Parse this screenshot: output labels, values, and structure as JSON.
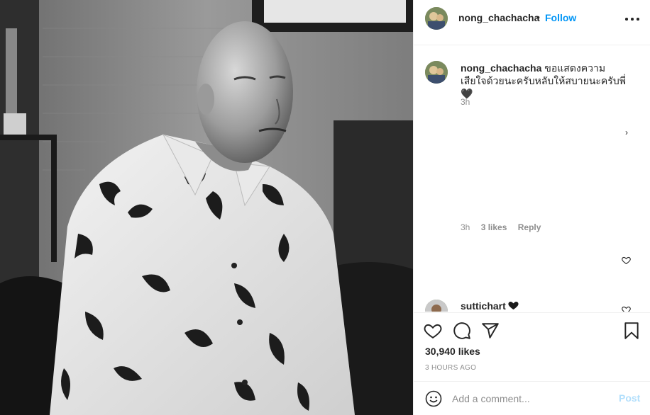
{
  "header": {
    "username": "nong_chachacha",
    "separator": "•",
    "follow_label": "Follow",
    "more_icon": "more-options-icon"
  },
  "caption": {
    "username": "nong_chachacha",
    "text": "ขอแสดงความเสียใจด้วยนะครับหลับให้สบายนะครับพี่🖤",
    "time": "3h"
  },
  "comment_meta": {
    "time": "3h",
    "likes": "3 likes",
    "reply": "Reply"
  },
  "chevron": "›",
  "comment2": {
    "username": "suttichart",
    "emoji_icon": "black-heart-icon"
  },
  "actions": {
    "like_icon": "heart-icon",
    "comment_icon": "comment-icon",
    "share_icon": "share-icon",
    "save_icon": "bookmark-icon"
  },
  "likes_count": "30,940 likes",
  "posted_ago": "3 HOURS AGO",
  "add_comment": {
    "placeholder": "Add a comment...",
    "value": "",
    "post_label": "Post"
  },
  "colors": {
    "link_blue": "#0095f6",
    "post_disabled": "#b2dffc",
    "muted": "#8e8e8e",
    "text": "#262626",
    "border": "#efefef"
  }
}
